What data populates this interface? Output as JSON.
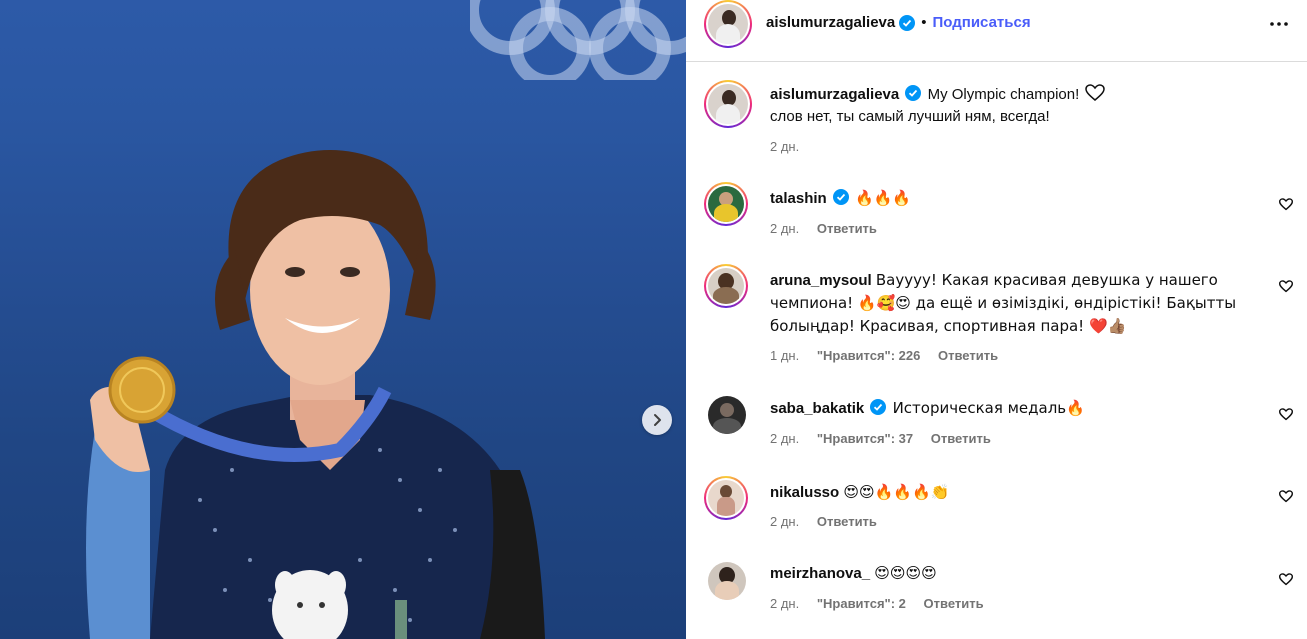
{
  "post": {
    "author": "aislumurzagalieva",
    "follow_label": "Подписаться",
    "caption_line1": "My Olympic champion!",
    "caption_line2": "слов нет, ты самый лучший ням, всегда!",
    "caption_age": "2 дн."
  },
  "comments": [
    {
      "user": "talashin",
      "verified": true,
      "text": "🔥🔥🔥",
      "age": "2 дн.",
      "likes": "",
      "reply": "Ответить"
    },
    {
      "user": "aruna_mysoul",
      "verified": false,
      "text_l1": "Вауууу! Какая красивая девушка у нашего",
      "text_l2": "чемпиона! 🔥🥰😍 да ещё и өзіміздікі, өндірістікі! Бақытты",
      "text_l3": "болыңдар! Красивая, спортивная пара! ❤️👍🏽",
      "age": "1 дн.",
      "likes": "\"Нравится\": 226",
      "reply": "Ответить"
    },
    {
      "user": "saba_bakatik",
      "verified": true,
      "text": "Историческая медаль🔥",
      "age": "2 дн.",
      "likes": "\"Нравится\": 37",
      "reply": "Ответить"
    },
    {
      "user": "nikalusso",
      "verified": false,
      "text": "😍😍🔥🔥🔥👏",
      "age": "2 дн.",
      "likes": "",
      "reply": "Ответить"
    },
    {
      "user": "meirzhanova_",
      "verified": false,
      "text": "😍😍😍😍",
      "age": "2 дн.",
      "likes": "\"Нравится\": 2",
      "reply": "Ответить"
    }
  ],
  "icons": {
    "verified": "verified-badge-icon",
    "more": "more-horizontal-icon",
    "like": "heart-outline-icon",
    "next": "chevron-right-icon"
  },
  "colors": {
    "follow": "#4a5df9",
    "verified": "#0095f6",
    "meta": "#737373"
  }
}
